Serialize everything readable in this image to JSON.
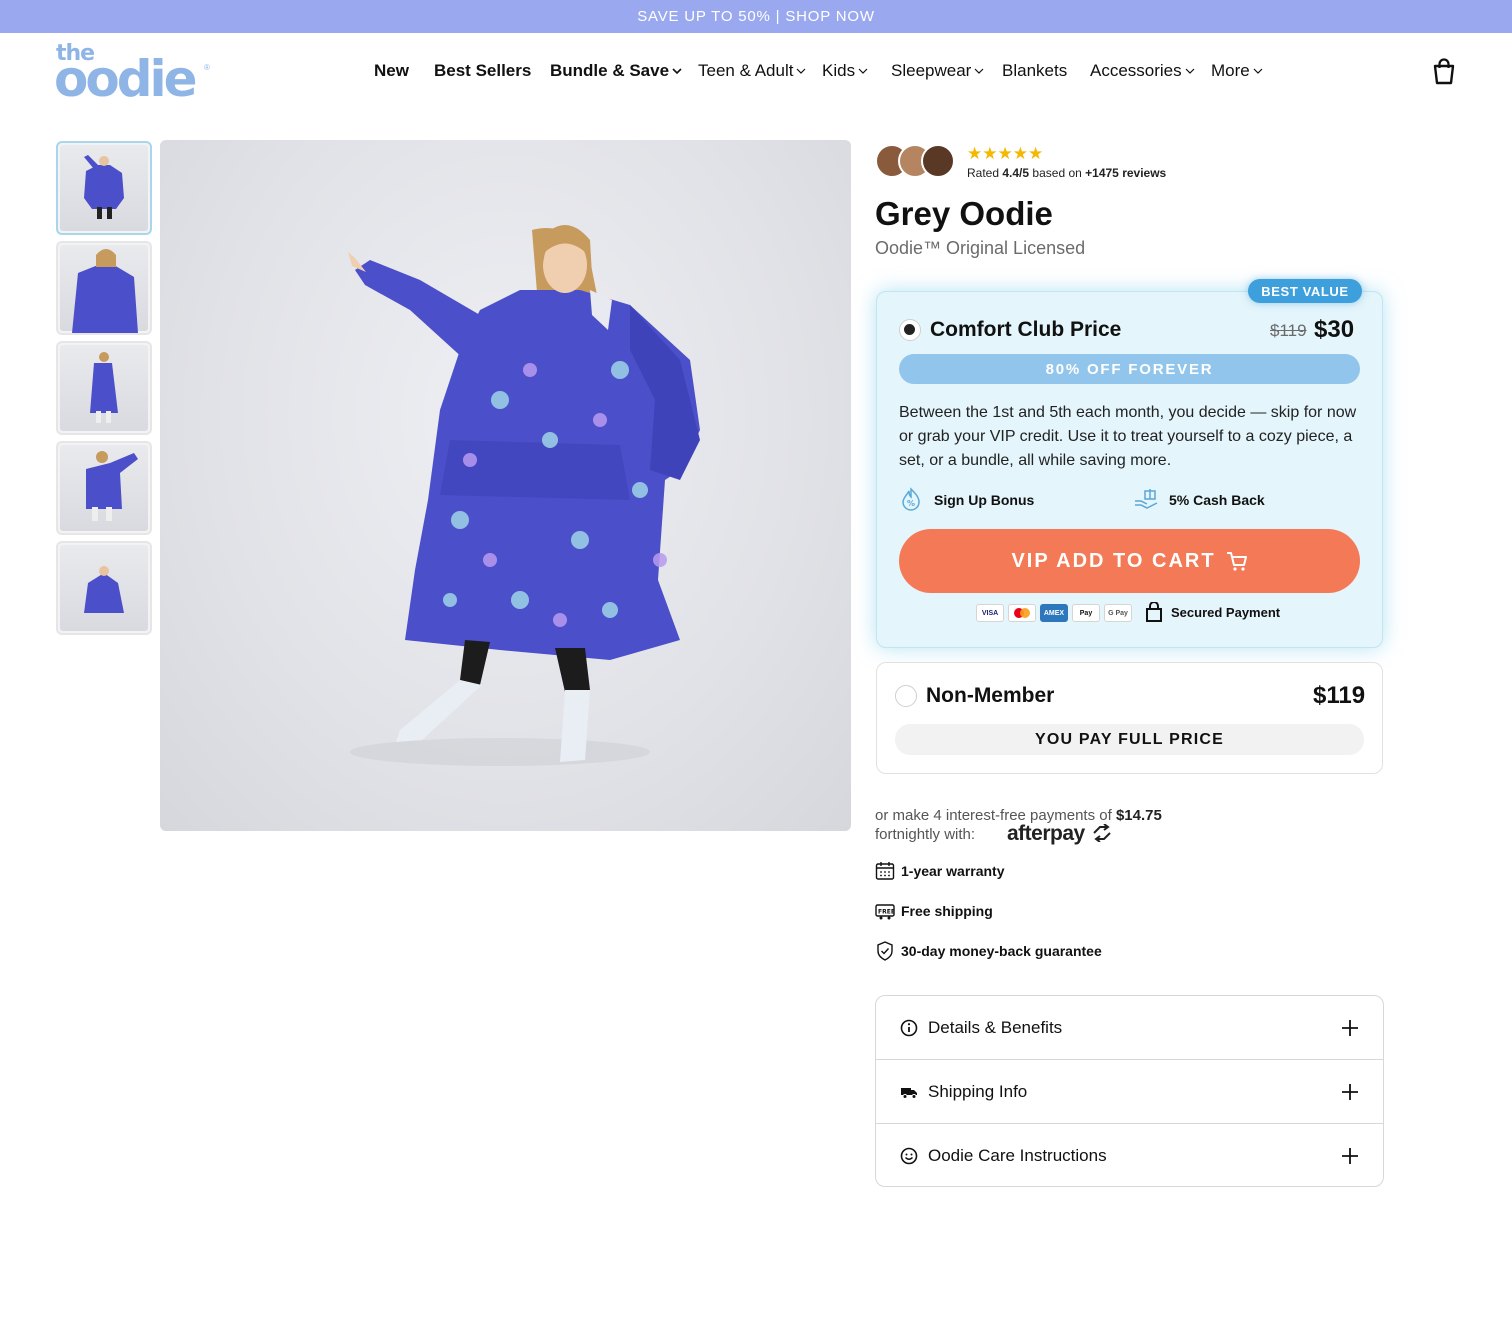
{
  "promo": {
    "text": "SAVE UP TO 50% | SHOP NOW"
  },
  "logo": {
    "the": "the",
    "oodie": "oodie",
    "reg": "®"
  },
  "nav": [
    {
      "label": "New",
      "dropdown": false
    },
    {
      "label": "Best Sellers",
      "dropdown": false
    },
    {
      "label": "Bundle & Save",
      "dropdown": true
    },
    {
      "label": "Teen & Adult",
      "dropdown": true
    },
    {
      "label": "Kids",
      "dropdown": true
    },
    {
      "label": "Sleepwear",
      "dropdown": true
    },
    {
      "label": "Blankets",
      "dropdown": false
    },
    {
      "label": "Accessories",
      "dropdown": true
    },
    {
      "label": "More",
      "dropdown": true
    }
  ],
  "product": {
    "stars": "★★★★★",
    "rating_prefix": "Rated",
    "rating_value": "4.4/5",
    "rating_mid": "based on",
    "review_count": "+1475 reviews",
    "title": "Grey Oodie",
    "subtitle": "Oodie™ Original Licensed"
  },
  "club": {
    "badge": "BEST VALUE",
    "title": "Comfort Club Price",
    "old_price": "$119",
    "price": "$30",
    "discount": "80% OFF FOREVER",
    "description": "Between the 1st and 5th each month, you decide — skip for now or grab your VIP credit. Use it to treat yourself to a cozy piece, a set, or a bundle, all while saving more.",
    "perk1": "Sign Up Bonus",
    "perk2": "5% Cash Back",
    "cta": "VIP ADD TO CART",
    "payment_methods": [
      "VISA",
      "MC",
      "AMEX",
      "Pay",
      "G Pay"
    ],
    "secured": "Secured Payment"
  },
  "nonmember": {
    "title": "Non-Member",
    "price": "$119",
    "pill": "YOU PAY FULL PRICE"
  },
  "afterpay": {
    "line1_prefix": "or make 4 interest-free payments of",
    "amount": "$14.75",
    "line2": "fortnightly with:",
    "logo": "afterpay"
  },
  "features": [
    "1-year warranty",
    "Free shipping",
    "30-day money-back guarantee"
  ],
  "accordion": [
    "Details & Benefits",
    "Shipping Info",
    "Oodie Care Instructions"
  ],
  "colors": {
    "promo_bg": "#9aa9ef",
    "logo": "#8fb5e6",
    "cta": "#f47a57",
    "club_bg": "#e4f5fb",
    "badge": "#3d9fdc",
    "star": "#f5b800",
    "oodie_fabric": "#4b4fc9"
  }
}
